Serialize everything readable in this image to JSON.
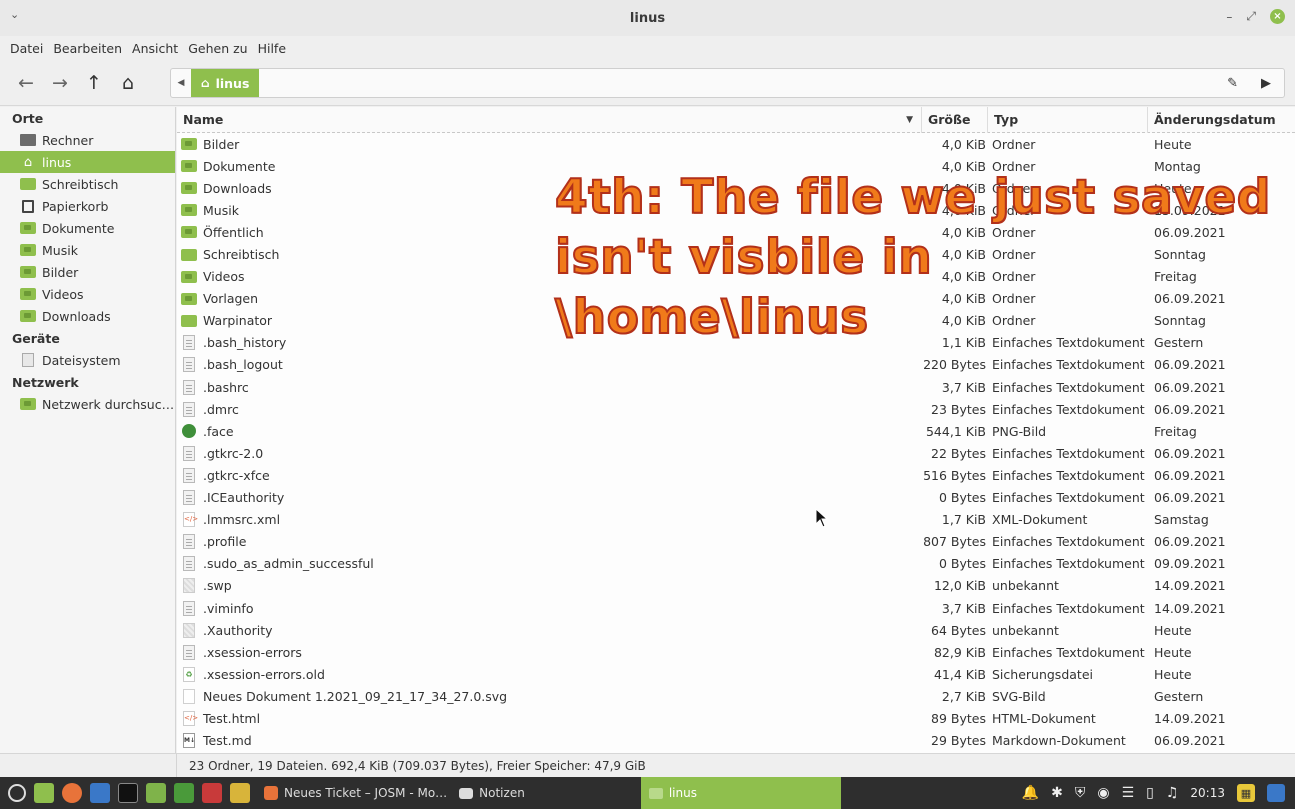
{
  "window": {
    "title": "linus",
    "min_glyph": "–",
    "max_glyph": "⤢",
    "close_glyph": "×",
    "menu_glyph": "⌄"
  },
  "menubar": [
    "Datei",
    "Bearbeiten",
    "Ansicht",
    "Gehen zu",
    "Hilfe"
  ],
  "toolbar": {
    "back_glyph": "←",
    "forward_glyph": "→",
    "up_glyph": "↑",
    "home_glyph": "⌂",
    "path_left_glyph": "◀",
    "path_right_glyph": "▶",
    "edit_glyph": "✎",
    "crumb": "linus"
  },
  "sidebar": {
    "sections": [
      {
        "header": "Orte",
        "items": [
          {
            "label": "Rechner",
            "icon": "computer-icon"
          },
          {
            "label": "linus",
            "icon": "home-icon",
            "active": true
          },
          {
            "label": "Schreibtisch",
            "icon": "folder-icon"
          },
          {
            "label": "Papierkorb",
            "icon": "trash-icon"
          },
          {
            "label": "Dokumente",
            "icon": "folder-icon"
          },
          {
            "label": "Musik",
            "icon": "folder-icon"
          },
          {
            "label": "Bilder",
            "icon": "folder-icon"
          },
          {
            "label": "Videos",
            "icon": "folder-icon"
          },
          {
            "label": "Downloads",
            "icon": "folder-icon"
          }
        ]
      },
      {
        "header": "Geräte",
        "items": [
          {
            "label": "Dateisystem",
            "icon": "drive-icon"
          }
        ]
      },
      {
        "header": "Netzwerk",
        "items": [
          {
            "label": "Netzwerk durchsuc…",
            "icon": "network-folder-icon"
          }
        ]
      }
    ]
  },
  "columns": {
    "name": "Name",
    "size": "Größe",
    "type": "Typ",
    "date": "Änderungsdatum",
    "sort_glyph": "▼"
  },
  "files": [
    {
      "name": "Bilder",
      "size": "4,0 KiB",
      "type": "Ordner",
      "date": "Heute",
      "icon": "folder"
    },
    {
      "name": "Dokumente",
      "size": "4,0 KiB",
      "type": "Ordner",
      "date": "Montag",
      "icon": "folder"
    },
    {
      "name": "Downloads",
      "size": "4,0 KiB",
      "type": "Ordner",
      "date": "Heute",
      "icon": "folder"
    },
    {
      "name": "Musik",
      "size": "4,0 KiB",
      "type": "Ordner",
      "date": "15.09.2021",
      "icon": "folder"
    },
    {
      "name": "Öffentlich",
      "size": "4,0 KiB",
      "type": "Ordner",
      "date": "06.09.2021",
      "icon": "folder"
    },
    {
      "name": "Schreibtisch",
      "size": "4,0 KiB",
      "type": "Ordner",
      "date": "Sonntag",
      "icon": "plainfolder"
    },
    {
      "name": "Videos",
      "size": "4,0 KiB",
      "type": "Ordner",
      "date": "Freitag",
      "icon": "folder"
    },
    {
      "name": "Vorlagen",
      "size": "4,0 KiB",
      "type": "Ordner",
      "date": "06.09.2021",
      "icon": "folder"
    },
    {
      "name": "Warpinator",
      "size": "4,0 KiB",
      "type": "Ordner",
      "date": "Sonntag",
      "icon": "plainfolder"
    },
    {
      "name": ".bash_history",
      "size": "1,1 KiB",
      "type": "Einfaches Textdokument",
      "date": "Gestern",
      "icon": "doc"
    },
    {
      "name": ".bash_logout",
      "size": "220 Bytes",
      "type": "Einfaches Textdokument",
      "date": "06.09.2021",
      "icon": "doc"
    },
    {
      "name": ".bashrc",
      "size": "3,7 KiB",
      "type": "Einfaches Textdokument",
      "date": "06.09.2021",
      "icon": "doc"
    },
    {
      "name": ".dmrc",
      "size": "23 Bytes",
      "type": "Einfaches Textdokument",
      "date": "06.09.2021",
      "icon": "doc"
    },
    {
      "name": ".face",
      "size": "544,1 KiB",
      "type": "PNG-Bild",
      "date": "Freitag",
      "icon": "face"
    },
    {
      "name": ".gtkrc-2.0",
      "size": "22 Bytes",
      "type": "Einfaches Textdokument",
      "date": "06.09.2021",
      "icon": "doc"
    },
    {
      "name": ".gtkrc-xfce",
      "size": "516 Bytes",
      "type": "Einfaches Textdokument",
      "date": "06.09.2021",
      "icon": "doc"
    },
    {
      "name": ".ICEauthority",
      "size": "0 Bytes",
      "type": "Einfaches Textdokument",
      "date": "06.09.2021",
      "icon": "doc"
    },
    {
      "name": ".lmmsrc.xml",
      "size": "1,7 KiB",
      "type": "XML-Dokument",
      "date": "Samstag",
      "icon": "code"
    },
    {
      "name": ".profile",
      "size": "807 Bytes",
      "type": "Einfaches Textdokument",
      "date": "06.09.2021",
      "icon": "doc"
    },
    {
      "name": ".sudo_as_admin_successful",
      "size": "0 Bytes",
      "type": "Einfaches Textdokument",
      "date": "09.09.2021",
      "icon": "doc"
    },
    {
      "name": ".swp",
      "size": "12,0 KiB",
      "type": "unbekannt",
      "date": "14.09.2021",
      "icon": "unknown"
    },
    {
      "name": ".viminfo",
      "size": "3,7 KiB",
      "type": "Einfaches Textdokument",
      "date": "14.09.2021",
      "icon": "doc"
    },
    {
      "name": ".Xauthority",
      "size": "64 Bytes",
      "type": "unbekannt",
      "date": "Heute",
      "icon": "unknown"
    },
    {
      "name": ".xsession-errors",
      "size": "82,9 KiB",
      "type": "Einfaches Textdokument",
      "date": "Heute",
      "icon": "doc"
    },
    {
      "name": ".xsession-errors.old",
      "size": "41,4 KiB",
      "type": "Sicherungsdatei",
      "date": "Heute",
      "icon": "backup"
    },
    {
      "name": "Neues Dokument 1.2021_09_21_17_34_27.0.svg",
      "size": "2,7 KiB",
      "type": "SVG-Bild",
      "date": "Gestern",
      "icon": "blank"
    },
    {
      "name": "Test.html",
      "size": "89 Bytes",
      "type": "HTML-Dokument",
      "date": "14.09.2021",
      "icon": "code"
    },
    {
      "name": "Test.md",
      "size": "29 Bytes",
      "type": "Markdown-Dokument",
      "date": "06.09.2021",
      "icon": "markdown"
    }
  ],
  "status": "23 Ordner, 19 Dateien. 692,4 KiB (709.037 Bytes), Freier Speicher: 47,9 GiB",
  "annotation": "4th: The file we just saved\nisn't visbile in\n\\home\\linus",
  "taskbar": {
    "tasks": [
      {
        "label": "Neues Ticket – JOSM - Mo…"
      },
      {
        "label": "Notizen"
      }
    ],
    "active_task": "linus",
    "clock": "20:13"
  },
  "colors": {
    "accent": "#8fbf4d",
    "annotation": "#f07a1a",
    "taskbar": "#2e2e2e"
  }
}
